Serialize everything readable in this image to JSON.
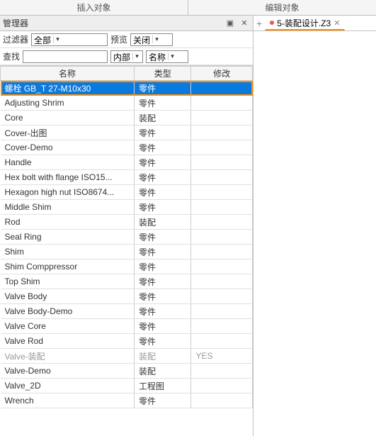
{
  "top_tabs": {
    "insert": "插入对象",
    "edit": "编辑对象"
  },
  "panel": {
    "title": "管理器",
    "minimize_icon": "▣",
    "close_icon": "✕"
  },
  "filter_row": {
    "filter_label": "过滤器",
    "filter_value": "全部",
    "preview_label": "预览",
    "preview_value": "关闭"
  },
  "search_row": {
    "search_label": "查找",
    "search_value": "",
    "scope_value": "内部",
    "field_value": "名称"
  },
  "columns": {
    "name": "名称",
    "type": "类型",
    "mod": "修改"
  },
  "col_widths": {
    "name": 188,
    "type": 80,
    "mod": 86
  },
  "rows": [
    {
      "name": "螺栓 GB_T 27-M10x30",
      "type": "零件",
      "mod": "",
      "selected": true,
      "highlight": true
    },
    {
      "name": "Adjusting Shrim",
      "type": "零件",
      "mod": ""
    },
    {
      "name": "Core",
      "type": "装配",
      "mod": ""
    },
    {
      "name": "Cover-出图",
      "type": "零件",
      "mod": ""
    },
    {
      "name": "Cover-Demo",
      "type": "零件",
      "mod": ""
    },
    {
      "name": "Handle",
      "type": "零件",
      "mod": ""
    },
    {
      "name": "Hex bolt with flange ISO15...",
      "type": "零件",
      "mod": ""
    },
    {
      "name": "Hexagon high nut ISO8674...",
      "type": "零件",
      "mod": ""
    },
    {
      "name": "Middle Shim",
      "type": "零件",
      "mod": ""
    },
    {
      "name": "Rod",
      "type": "装配",
      "mod": ""
    },
    {
      "name": "Seal Ring",
      "type": "零件",
      "mod": ""
    },
    {
      "name": "Shim",
      "type": "零件",
      "mod": ""
    },
    {
      "name": "Shim Comppressor",
      "type": "零件",
      "mod": ""
    },
    {
      "name": "Top Shim",
      "type": "零件",
      "mod": ""
    },
    {
      "name": "Valve Body",
      "type": "零件",
      "mod": ""
    },
    {
      "name": "Valve Body-Demo",
      "type": "零件",
      "mod": ""
    },
    {
      "name": "Valve Core",
      "type": "零件",
      "mod": ""
    },
    {
      "name": "Valve Rod",
      "type": "零件",
      "mod": ""
    },
    {
      "name": "Valve-装配",
      "type": "装配",
      "mod": "YES",
      "muted": true
    },
    {
      "name": "Valve-Demo",
      "type": "装配",
      "mod": ""
    },
    {
      "name": "Valve_2D",
      "type": "工程图",
      "mod": ""
    },
    {
      "name": "Wrench",
      "type": "零件",
      "mod": ""
    }
  ],
  "doc_tab": {
    "label": "5-装配设计.Z3"
  }
}
